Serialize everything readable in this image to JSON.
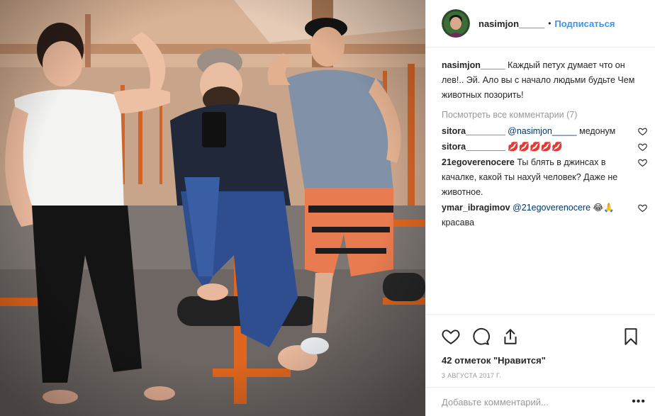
{
  "post": {
    "author": "nasimjon_____",
    "follow_label": "Подписаться",
    "separator": "•",
    "caption": "Каждый петух думает что он лев!.. Эй. Ало вы с начало людьми будьте Чем животных позорить!",
    "view_all_comments": "Посмотреть все комментарии (7)",
    "likes": "42 отметок \"Нравится\"",
    "date": "3 АВГУСТА 2017 Г.",
    "add_comment_placeholder": "Добавьте комментарий...",
    "more_icon": "more-dots-icon"
  },
  "comments": [
    {
      "user": "sitora________",
      "mention": "@nasimjon_____",
      "text": " медонум"
    },
    {
      "user": "sitora________",
      "mention": "",
      "text": " 💋💋💋💋💋"
    },
    {
      "user": "21egoverenocere",
      "mention": "",
      "text": " Ты блять в джинсах в качалке, какой ты нахуй человек? Даже не животное."
    },
    {
      "user": "ymar_ibragimov",
      "mention": "@21egoverenocere",
      "text": " 😂🙏 красава"
    }
  ],
  "icons": {
    "like": "heart-icon",
    "comment": "comment-icon",
    "share": "share-icon",
    "save": "bookmark-icon"
  },
  "colors": {
    "accent": "#3897f0",
    "mention": "#003569",
    "muted": "#999999",
    "text": "#262626"
  }
}
